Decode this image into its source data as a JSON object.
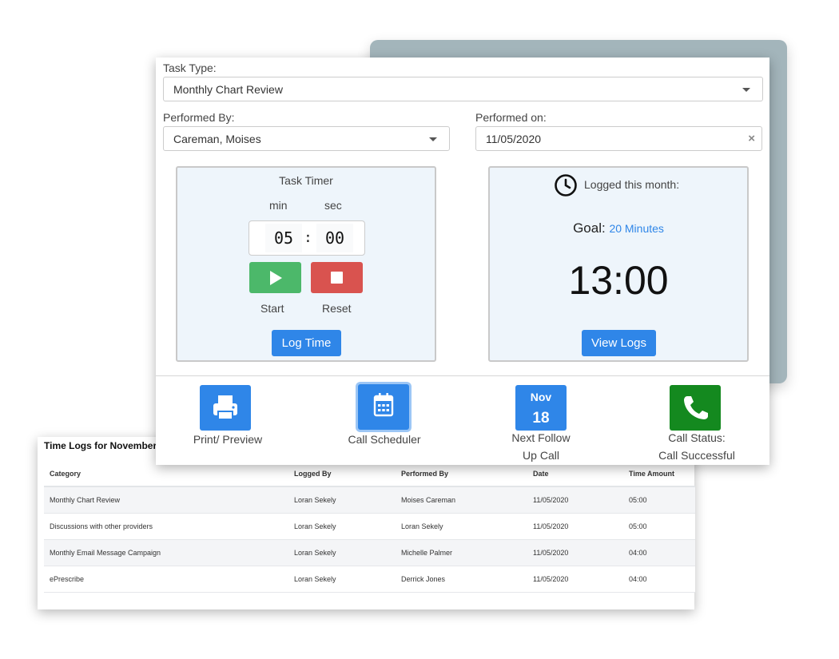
{
  "task_type": {
    "label": "Task Type:",
    "value": "Monthly Chart Review"
  },
  "performed_by": {
    "label": "Performed By:",
    "value": "Careman, Moises"
  },
  "performed_on": {
    "label": "Performed on:",
    "value": "11/05/2020",
    "clear_glyph": "×"
  },
  "timer": {
    "title": "Task Timer",
    "min_label": "min",
    "sec_label": "sec",
    "minutes": "05",
    "seconds": "00",
    "separator": ":",
    "start_label": "Start",
    "reset_label": "Reset",
    "log_button": "Log Time"
  },
  "logged": {
    "title": "Logged this month:",
    "goal_label": "Goal:",
    "goal_value": "20 Minutes",
    "total": "13:00",
    "view_button": "View Logs"
  },
  "actions": {
    "print_label": "Print/ Preview",
    "scheduler_label": "Call Scheduler",
    "next_month": "Nov",
    "next_day": "18",
    "next_label_1": "Next Follow",
    "next_label_2": "Up Call",
    "status_label_1": "Call Status:",
    "status_label_2": "Call Successful"
  },
  "logs": {
    "title": "Time Logs for November",
    "headers": {
      "category": "Category",
      "logged_by": "Logged By",
      "performed_by": "Performed By",
      "date": "Date",
      "amount": "Time Amount"
    },
    "rows": [
      {
        "category": "Monthly Chart Review",
        "logged_by": "Loran Sekely",
        "performed_by": "Moises Careman",
        "date": "11/05/2020",
        "amount": "05:00"
      },
      {
        "category": "Discussions with other providers",
        "logged_by": "Loran Sekely",
        "performed_by": "Loran Sekely",
        "date": "11/05/2020",
        "amount": "05:00"
      },
      {
        "category": "Monthly Email Message Campaign",
        "logged_by": "Loran Sekely",
        "performed_by": "Michelle Palmer",
        "date": "11/05/2020",
        "amount": "04:00"
      },
      {
        "category": "ePrescribe",
        "logged_by": "Loran Sekely",
        "performed_by": "Derrick Jones",
        "date": "11/05/2020",
        "amount": "04:00"
      }
    ]
  },
  "colors": {
    "primary": "#2f86e8",
    "start": "#4cb86a",
    "reset": "#d9534f",
    "call_status": "#14891f",
    "panel_bg": "#eef5fb",
    "back_card": "#a3b5bb"
  },
  "icons": {
    "print": "printer-icon",
    "scheduler": "calendar-icon",
    "call": "phone-icon",
    "clock": "clock-icon"
  }
}
